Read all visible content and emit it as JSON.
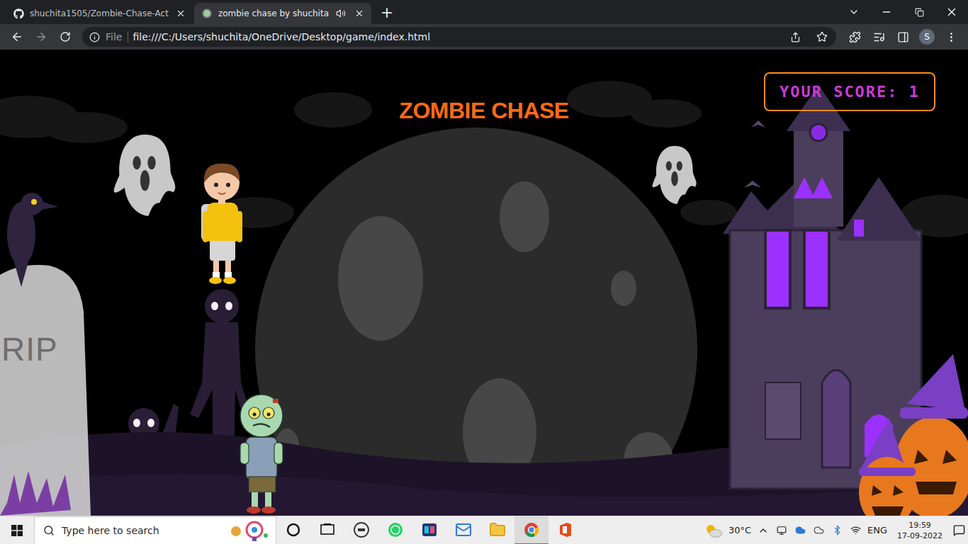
{
  "browser": {
    "tabs": [
      {
        "label": "shuchita1505/Zombie-Chase-Act",
        "selected": false,
        "audio": false
      },
      {
        "label": "zombie chase by shuchita",
        "selected": true,
        "audio": true
      }
    ],
    "new_tab": "+",
    "address": {
      "scheme_label": "File",
      "url": "file:///C:/Users/shuchita/OneDrive/Desktop/game/index.html"
    },
    "profile": "S"
  },
  "game": {
    "title": "ZOMBIE CHASE",
    "score": "YOUR SCORE: 1",
    "tombstone": "RIP"
  },
  "taskbar": {
    "search_placeholder": "Type here to search",
    "apps": [
      {
        "kind": "cortana",
        "running": false
      },
      {
        "kind": "taskview",
        "running": false
      },
      {
        "kind": "dell",
        "running": false
      },
      {
        "kind": "whatsapp",
        "running": false
      },
      {
        "kind": "store",
        "running": false
      },
      {
        "kind": "mail",
        "running": false
      },
      {
        "kind": "folder",
        "running": false
      },
      {
        "kind": "chrome",
        "running": true
      },
      {
        "kind": "office",
        "running": false
      }
    ],
    "weather": "30°C",
    "language": "ENG",
    "time": "19:59",
    "date": "17-09-2022"
  }
}
